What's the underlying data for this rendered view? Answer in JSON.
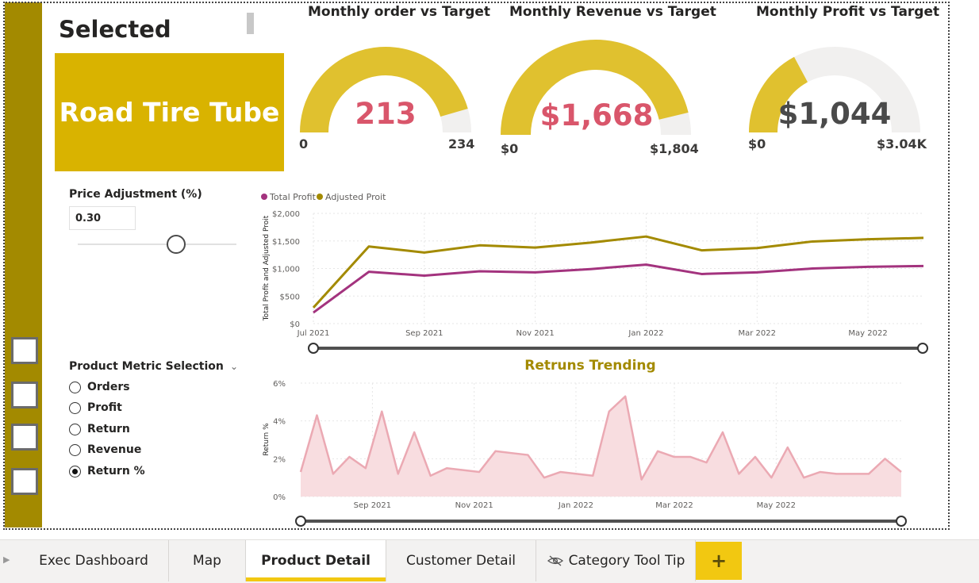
{
  "selected_title": "Selected",
  "product_name": "Road Tire Tube",
  "gauges": [
    {
      "title": "Monthly order vs Target",
      "value_text": "213",
      "value": 213,
      "min_text": "0",
      "max_text": "234",
      "min": 0,
      "max": 234,
      "value_color": "#d9566b"
    },
    {
      "title": "Monthly Revenue vs Target",
      "value_text": "$1,668",
      "value": 1668,
      "min_text": "$0",
      "max_text": "$1,804",
      "min": 0,
      "max": 1804,
      "value_color": "#d9566b"
    },
    {
      "title": "Monthly Profit vs Target",
      "value_text": "$1,044",
      "value": 1044,
      "min_text": "$0",
      "max_text": "$3.04K",
      "min": 0,
      "max": 3040,
      "value_color": "#4a4a4a"
    }
  ],
  "gauge_fill_color": "#e0c12f",
  "gauge_track_color": "#f1f0ef",
  "price_adjustment": {
    "label": "Price Adjustment (%)",
    "value": "0.30",
    "slider_fraction": 0.62
  },
  "metric_selection": {
    "label": "Product Metric Selection",
    "options": [
      {
        "label": "Orders",
        "selected": false
      },
      {
        "label": "Profit",
        "selected": false
      },
      {
        "label": "Return",
        "selected": false
      },
      {
        "label": "Revenue",
        "selected": false
      },
      {
        "label": "Return %",
        "selected": true
      }
    ]
  },
  "chart_data": [
    {
      "type": "line",
      "title": "",
      "legend": [
        "Total Profit",
        "Adjusted Proit"
      ],
      "legend_placement": "top-left",
      "ylabel": "Total Profit and Adjusted Proit",
      "xlabel": "",
      "x": [
        "2021-07",
        "2021-08",
        "2021-09",
        "2021-10",
        "2021-11",
        "2021-12",
        "2022-01",
        "2022-02",
        "2022-03",
        "2022-04",
        "2022-05",
        "2022-06"
      ],
      "x_tick_labels": [
        "Jul 2021",
        "Sep 2021",
        "Nov 2021",
        "Jan 2022",
        "Mar 2022",
        "May 2022"
      ],
      "y_tick_labels": [
        "$0",
        "$500",
        "$1,000",
        "$1,500",
        "$2,000"
      ],
      "ylim": [
        0,
        2000
      ],
      "grid": true,
      "series": [
        {
          "name": "Total Profit",
          "color": "#a3337e",
          "values": [
            200,
            940,
            870,
            950,
            930,
            990,
            1070,
            900,
            930,
            1000,
            1030,
            1045
          ]
        },
        {
          "name": "Adjusted Proit",
          "color": "#a38a00",
          "values": [
            290,
            1400,
            1290,
            1420,
            1380,
            1470,
            1580,
            1330,
            1370,
            1490,
            1530,
            1555
          ]
        }
      ]
    },
    {
      "type": "area",
      "title": "Retruns Trending",
      "ylabel": "Return %",
      "xlabel": "",
      "x_start": "2021-07-20",
      "x_end": "2022-07-15",
      "x_tick_labels": [
        "Sep 2021",
        "Nov 2021",
        "Jan 2022",
        "Mar 2022",
        "May 2022"
      ],
      "y_tick_labels": [
        "0%",
        "2%",
        "4%",
        "6%"
      ],
      "ylim": [
        0,
        6
      ],
      "grid": true,
      "color": "#eba9b3",
      "fill": "#f8dde0",
      "values": [
        1.3,
        4.3,
        1.2,
        2.1,
        1.5,
        4.5,
        1.2,
        3.4,
        1.1,
        1.5,
        1.4,
        1.3,
        2.4,
        2.3,
        2.2,
        1.0,
        1.3,
        1.2,
        1.1,
        4.5,
        5.3,
        0.9,
        2.4,
        2.1,
        2.1,
        1.8,
        3.4,
        1.2,
        2.1,
        1.0,
        2.6,
        1.0,
        1.3,
        1.2,
        1.2,
        1.2,
        2.0,
        1.3
      ]
    }
  ],
  "tabs": [
    {
      "label": "Exec Dashboard",
      "active": false
    },
    {
      "label": "Map",
      "active": false
    },
    {
      "label": "Product Detail",
      "active": true
    },
    {
      "label": "Customer Detail",
      "active": false
    },
    {
      "label": "Category Tool Tip",
      "active": false,
      "icon": "hidden-eye-icon"
    }
  ],
  "add_tab_label": "+"
}
